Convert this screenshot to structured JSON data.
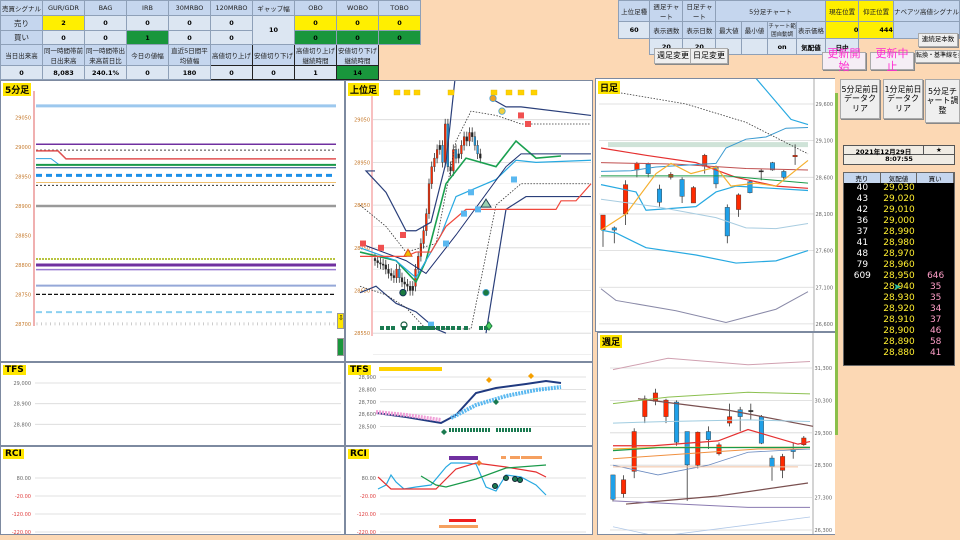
{
  "signals": {
    "headers": [
      "売買シグナル",
      "GUR/GDR",
      "BAG",
      "IRB",
      "30MRBO",
      "120MRBO",
      "ギャップ幅",
      "OBO",
      "WOBO",
      "TOBO"
    ],
    "sell": {
      "label": "売り",
      "values": [
        "2",
        "0",
        "0",
        "0",
        "0"
      ],
      "gap": "10",
      "obo": [
        "0",
        "0",
        "0"
      ]
    },
    "buy": {
      "label": "買い",
      "values": [
        "0",
        "0",
        "1",
        "0",
        "0"
      ],
      "obo": [
        "0",
        "0",
        "0"
      ]
    },
    "stats_headers": [
      "当日出来高",
      "同一時間帯前日出来高",
      "同一時間帯出来高前日比",
      "今日の値幅",
      "直近5日間平均値幅",
      "高値切り上げ",
      "安値切り下げ",
      "高値切り上げ継続時間",
      "安値切り下げ継続時間"
    ],
    "stats_values": [
      "0",
      "8,083",
      "240.1%",
      "0",
      "180",
      "0",
      "0",
      "1",
      "14"
    ]
  },
  "settings": {
    "h": [
      "上位足種",
      "週足チャート",
      "日足チャート",
      "5分足チャート",
      "現在位置",
      "仰正位置",
      "ナベアツ高値シグナル"
    ],
    "sub": [
      "表示週数",
      "表示日数",
      "最大値",
      "最小値",
      "チャート範囲自動調",
      "表示価格"
    ],
    "upper_type": "60",
    "current_pos": "0",
    "correct_pos": "444",
    "weeks": "20",
    "days": "20",
    "auto": "on",
    "price_mode": "気配値",
    "session": "日中",
    "consecutive_btn": "連続足本数",
    "tenkan_btn": "転換・基準線を描く"
  },
  "buttons": {
    "weekly_change": "週足変更",
    "daily_change": "日足変更",
    "start": "更新開始",
    "stop": "更新中止",
    "clear5": "5分足前日データクリア",
    "clear1": "1分足前日データクリア",
    "adjust5": "5分足チャート調整"
  },
  "datetime": {
    "date": "2021年12月29日",
    "star": "★",
    "time": "8:07:55"
  },
  "book": {
    "headers": [
      "売り",
      "気配値",
      "買い"
    ],
    "rows": [
      [
        "40",
        "29,030",
        ""
      ],
      [
        "43",
        "29,020",
        ""
      ],
      [
        "42",
        "29,010",
        ""
      ],
      [
        "36",
        "29,000",
        ""
      ],
      [
        "37",
        "28,990",
        ""
      ],
      [
        "41",
        "28,980",
        ""
      ],
      [
        "48",
        "28,970",
        ""
      ],
      [
        "79",
        "28,960",
        ""
      ],
      [
        "609",
        "28,950",
        "646"
      ],
      [
        "",
        "28,940",
        "35"
      ],
      [
        "",
        "28,930",
        "35"
      ],
      [
        "",
        "28,920",
        "34"
      ],
      [
        "",
        "28,910",
        "37"
      ],
      [
        "",
        "28,900",
        "46"
      ],
      [
        "",
        "28,890",
        "58"
      ],
      [
        "",
        "28,880",
        "41"
      ]
    ]
  },
  "charts": {
    "m5": {
      "title": "5分足",
      "yticks": [
        "29050",
        "29000",
        "28950",
        "28900",
        "28850",
        "28800",
        "28750",
        "28700"
      ],
      "levels": [
        [
          29070,
          "#9cc8ee",
          3,
          ""
        ],
        [
          29005,
          "#7030a0",
          1.5,
          ""
        ],
        [
          28995,
          "#444",
          1,
          "2 2"
        ],
        [
          28980,
          "#e05050",
          1.5,
          ""
        ],
        [
          28972,
          "#2ca0e0",
          1,
          ""
        ],
        [
          28970,
          "#1a9a4a",
          2,
          ""
        ],
        [
          28965,
          "#203a80",
          1,
          ""
        ],
        [
          28952,
          "#1e90e8",
          3,
          "6 4"
        ],
        [
          28940,
          "#f0c070",
          1,
          ""
        ],
        [
          28935,
          "#333",
          1,
          "2 2"
        ],
        [
          28900,
          "#999",
          2.5,
          ""
        ],
        [
          28810,
          "#a0b000",
          1.5,
          "2 1"
        ],
        [
          28800,
          "#7030a0",
          3,
          ""
        ],
        [
          28792,
          "#9a7ad0",
          1.5,
          ""
        ],
        [
          28765,
          "#95a8d8",
          2,
          ""
        ],
        [
          28750,
          "#111",
          1.2,
          "4 2"
        ],
        [
          28720,
          "#8cd0f0",
          2,
          "6 4"
        ]
      ]
    },
    "upper": {
      "title": "上位足",
      "yticks": [
        "29050",
        "28950",
        "28850",
        "28750",
        "28650",
        "28550"
      ],
      "closes": [
        28720,
        28715,
        28712,
        28710,
        28700,
        28690,
        28685,
        28680,
        28700,
        28680,
        28670,
        28665,
        28660,
        28650,
        28660,
        28700,
        28730,
        28760,
        28790,
        28830,
        28900,
        28940,
        28960,
        28980,
        28990,
        28950,
        29040,
        28940,
        28930,
        28980,
        28960,
        28970,
        28990,
        29010,
        29000,
        29020,
        29010,
        28990,
        28970,
        28960
      ]
    },
    "daily": {
      "title": "日足",
      "yticks": [
        "29,600",
        "29,100",
        "28,600",
        "28,100",
        "27,600",
        "27,100",
        "26,600"
      ],
      "ohlc": [
        [
          27885,
          28085,
          28085,
          27650
        ],
        [
          27910,
          27880,
          27930,
          27700
        ],
        [
          28100,
          28500,
          28560,
          27950
        ],
        [
          28700,
          28790,
          28810,
          28600
        ],
        [
          28780,
          28650,
          28800,
          28600
        ],
        [
          28440,
          28260,
          28500,
          28200
        ],
        [
          28600,
          28640,
          28670,
          28570
        ],
        [
          28570,
          28340,
          28600,
          28250
        ],
        [
          28250,
          28460,
          28480,
          28250
        ],
        [
          28750,
          28900,
          28920,
          28650
        ],
        [
          28740,
          28510,
          28760,
          28450
        ],
        [
          28190,
          27800,
          28230,
          27700
        ],
        [
          28160,
          28360,
          28380,
          28060
        ],
        [
          28540,
          28390,
          28560,
          28380
        ],
        [
          28690,
          28680,
          28720,
          28560
        ],
        [
          28800,
          28700,
          28810,
          28690
        ],
        [
          28680,
          28600,
          28700,
          28560
        ],
        [
          28880,
          28900,
          29050,
          28770
        ]
      ]
    },
    "weekly": {
      "title": "週足",
      "yticks": [
        "31,300",
        "30,300",
        "29,300",
        "28,300",
        "27,300",
        "26,300"
      ],
      "ohlc": [
        [
          28000,
          27250,
          28000,
          27180
        ],
        [
          27420,
          27850,
          27990,
          27300
        ],
        [
          28110,
          29340,
          29440,
          27900
        ],
        [
          29800,
          30350,
          30450,
          29600
        ],
        [
          30270,
          30530,
          30660,
          30150
        ],
        [
          29800,
          30310,
          30350,
          29600
        ],
        [
          30250,
          29010,
          30300,
          28900
        ],
        [
          29340,
          28310,
          29340,
          27200
        ],
        [
          28300,
          29320,
          29340,
          28200
        ],
        [
          29340,
          29090,
          29500,
          28800
        ],
        [
          28650,
          28930,
          29000,
          28600
        ],
        [
          29600,
          29800,
          30200,
          29500
        ],
        [
          30010,
          29800,
          30100,
          29350
        ],
        [
          29990,
          29980,
          30200,
          29700
        ],
        [
          29800,
          28980,
          29850,
          28950
        ],
        [
          28520,
          28260,
          28600,
          27820
        ],
        [
          28140,
          28570,
          28650,
          27900
        ],
        [
          28800,
          28720,
          29000,
          28500
        ],
        [
          28930,
          29140,
          29200,
          28900
        ]
      ]
    },
    "tfs_left": {
      "title": "TFS",
      "yticks": [
        "29,000",
        "28,900",
        "28,800"
      ]
    },
    "rci_left": {
      "title": "RCI",
      "yticks": [
        "80.00",
        "-20.00",
        "-120.00",
        "-220.00"
      ]
    },
    "tfs_right": {
      "title": "TFS",
      "yticks": [
        "28,900",
        "28,800",
        "28,700",
        "28,600",
        "28,500"
      ]
    },
    "rci_right": {
      "title": "RCI",
      "yticks": [
        "80.00",
        "-20.00",
        "-120.00",
        "-220.00"
      ]
    }
  },
  "colors": {
    "up": "#ff2a00",
    "down": "#1fa0e8",
    "sell": "#ffef00",
    "buy": "#19963c"
  }
}
